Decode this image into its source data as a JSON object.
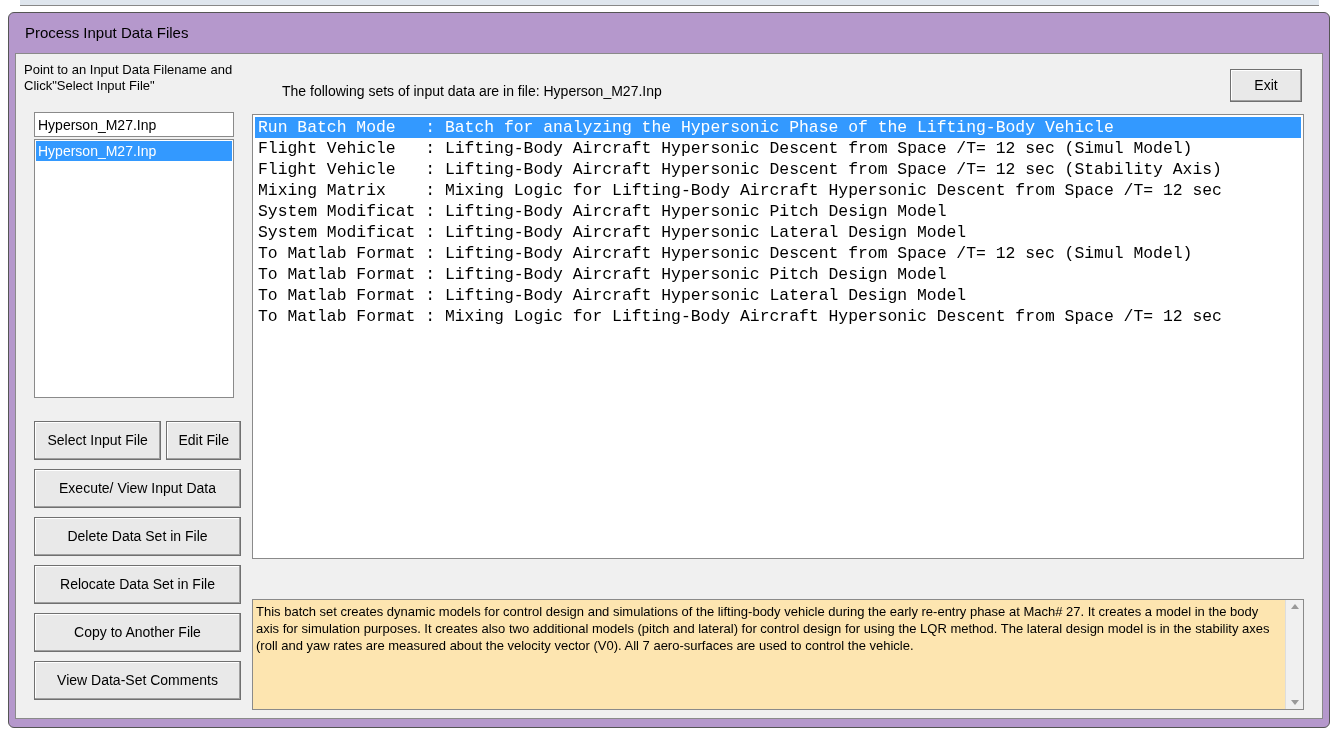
{
  "window": {
    "title": "Process Input Data Files"
  },
  "instructions": "Point to an Input Data Filename and Click\"Select Input File\"",
  "file_field": {
    "value": "Hyperson_M27.Inp"
  },
  "file_list": [
    {
      "label": "Hyperson_M27.Inp",
      "selected": true
    }
  ],
  "buttons": [
    [
      "Select Input File",
      "Edit File"
    ],
    [
      "Execute/ View Input Data"
    ],
    [
      "Delete Data Set in File"
    ],
    [
      "Relocate Data Set in File"
    ],
    [
      "Copy to Another File"
    ],
    [
      "View Data-Set Comments"
    ]
  ],
  "data_sets_heading": "The following sets of input data are in file: Hyperson_M27.Inp",
  "exit_button": "Exit",
  "data_sets": [
    {
      "label": "Run Batch Mode   : Batch for analyzing the Hypersonic Phase of the Lifting-Body Vehicle",
      "selected": true
    },
    {
      "label": "Flight Vehicle   : Lifting-Body Aircraft Hypersonic Descent from Space /T= 12 sec (Simul Model)",
      "selected": false
    },
    {
      "label": "Flight Vehicle   : Lifting-Body Aircraft Hypersonic Descent from Space /T= 12 sec (Stability Axis)",
      "selected": false
    },
    {
      "label": "Mixing Matrix    : Mixing Logic for Lifting-Body Aircraft Hypersonic Descent from Space /T= 12 sec",
      "selected": false
    },
    {
      "label": "System Modificat : Lifting-Body Aircraft Hypersonic Pitch Design Model",
      "selected": false
    },
    {
      "label": "System Modificat : Lifting-Body Aircraft Hypersonic Lateral Design Model",
      "selected": false
    },
    {
      "label": "To Matlab Format : Lifting-Body Aircraft Hypersonic Descent from Space /T= 12 sec (Simul Model)",
      "selected": false
    },
    {
      "label": "To Matlab Format : Lifting-Body Aircraft Hypersonic Pitch Design Model",
      "selected": false
    },
    {
      "label": "To Matlab Format : Lifting-Body Aircraft Hypersonic Lateral Design Model",
      "selected": false
    },
    {
      "label": "To Matlab Format : Mixing Logic for Lifting-Body Aircraft Hypersonic Descent from Space /T= 12 sec",
      "selected": false
    }
  ],
  "comments": "This batch set creates dynamic models for control design and simulations of the lifting-body  vehicle during the early re-entry phase at Mach# 27. It creates a model in the  body axis for simulation purposes. It creates also two additional models (pitch and lateral)  for control design for using the LQR method. The lateral design model is in the stability axes  (roll and yaw rates are measured about the velocity vector (V0). All 7 aero-surfaces are used  to control the vehicle."
}
